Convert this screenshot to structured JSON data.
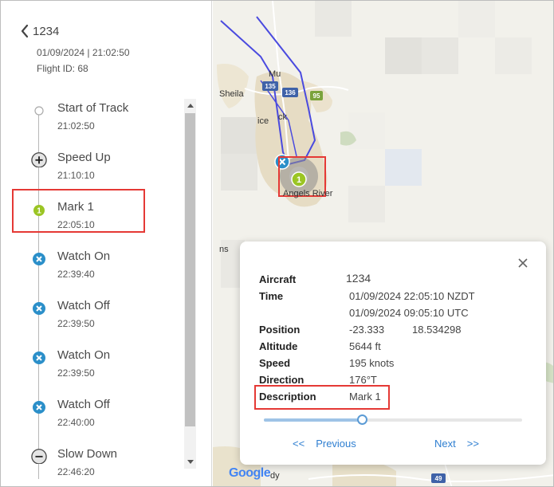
{
  "flight": {
    "name": "1234",
    "datetime": "01/09/2024 | 21:02:50",
    "flight_id": "Flight ID: 68"
  },
  "timeline": {
    "events": [
      {
        "label": "Start of Track",
        "time": "21:02:50",
        "icon": "start-circle-icon"
      },
      {
        "label": "Speed Up",
        "time": "21:10:10",
        "icon": "plus-circle-icon"
      },
      {
        "label": "Mark 1",
        "time": "22:05:10",
        "icon": "mark-1-icon",
        "badge": "1"
      },
      {
        "label": "Watch On",
        "time": "22:39:40",
        "icon": "watch-x-icon"
      },
      {
        "label": "Watch Off",
        "time": "22:39:50",
        "icon": "watch-x-icon"
      },
      {
        "label": "Watch On",
        "time": "22:39:50",
        "icon": "watch-x-icon"
      },
      {
        "label": "Watch Off",
        "time": "22:40:00",
        "icon": "watch-x-icon"
      },
      {
        "label": "Slow Down",
        "time": "22:46:20",
        "icon": "minus-circle-icon"
      }
    ]
  },
  "map": {
    "labels": {
      "sheila": "Sheila",
      "mu": "Mu",
      "ice": "ice",
      "ck": "ck",
      "angels_river": "Angels River",
      "ns": "ns",
      "dy": "dy"
    },
    "road_shields": [
      "135",
      "136",
      "95",
      "49"
    ],
    "marker_badge": "1",
    "google": "Google",
    "colors": {
      "route": "#4a4adf",
      "watch_marker": "#2b8fc9",
      "mark_marker": "#9bc524"
    }
  },
  "popup": {
    "rows": {
      "aircraft": {
        "key": "Aircraft",
        "value": "1234"
      },
      "time": {
        "key": "Time",
        "value": "01/09/2024 22:05:10 NZDT",
        "value2": "01/09/2024 09:05:10 UTC"
      },
      "position": {
        "key": "Position",
        "lat": "-23.333",
        "lon": "18.534298"
      },
      "altitude": {
        "key": "Altitude",
        "value": "5644 ft"
      },
      "speed": {
        "key": "Speed",
        "value": "195 knots"
      },
      "direction": {
        "key": "Direction",
        "value": "176°T"
      },
      "description": {
        "key": "Description",
        "value": "Mark 1"
      }
    },
    "slider_fraction": 0.38,
    "previous": {
      "arrows": "<<",
      "label": "Previous"
    },
    "next": {
      "label": "Next",
      "arrows": ">>"
    }
  },
  "accent_colors": {
    "highlight": "#e53935",
    "link": "#2f7fd1"
  }
}
